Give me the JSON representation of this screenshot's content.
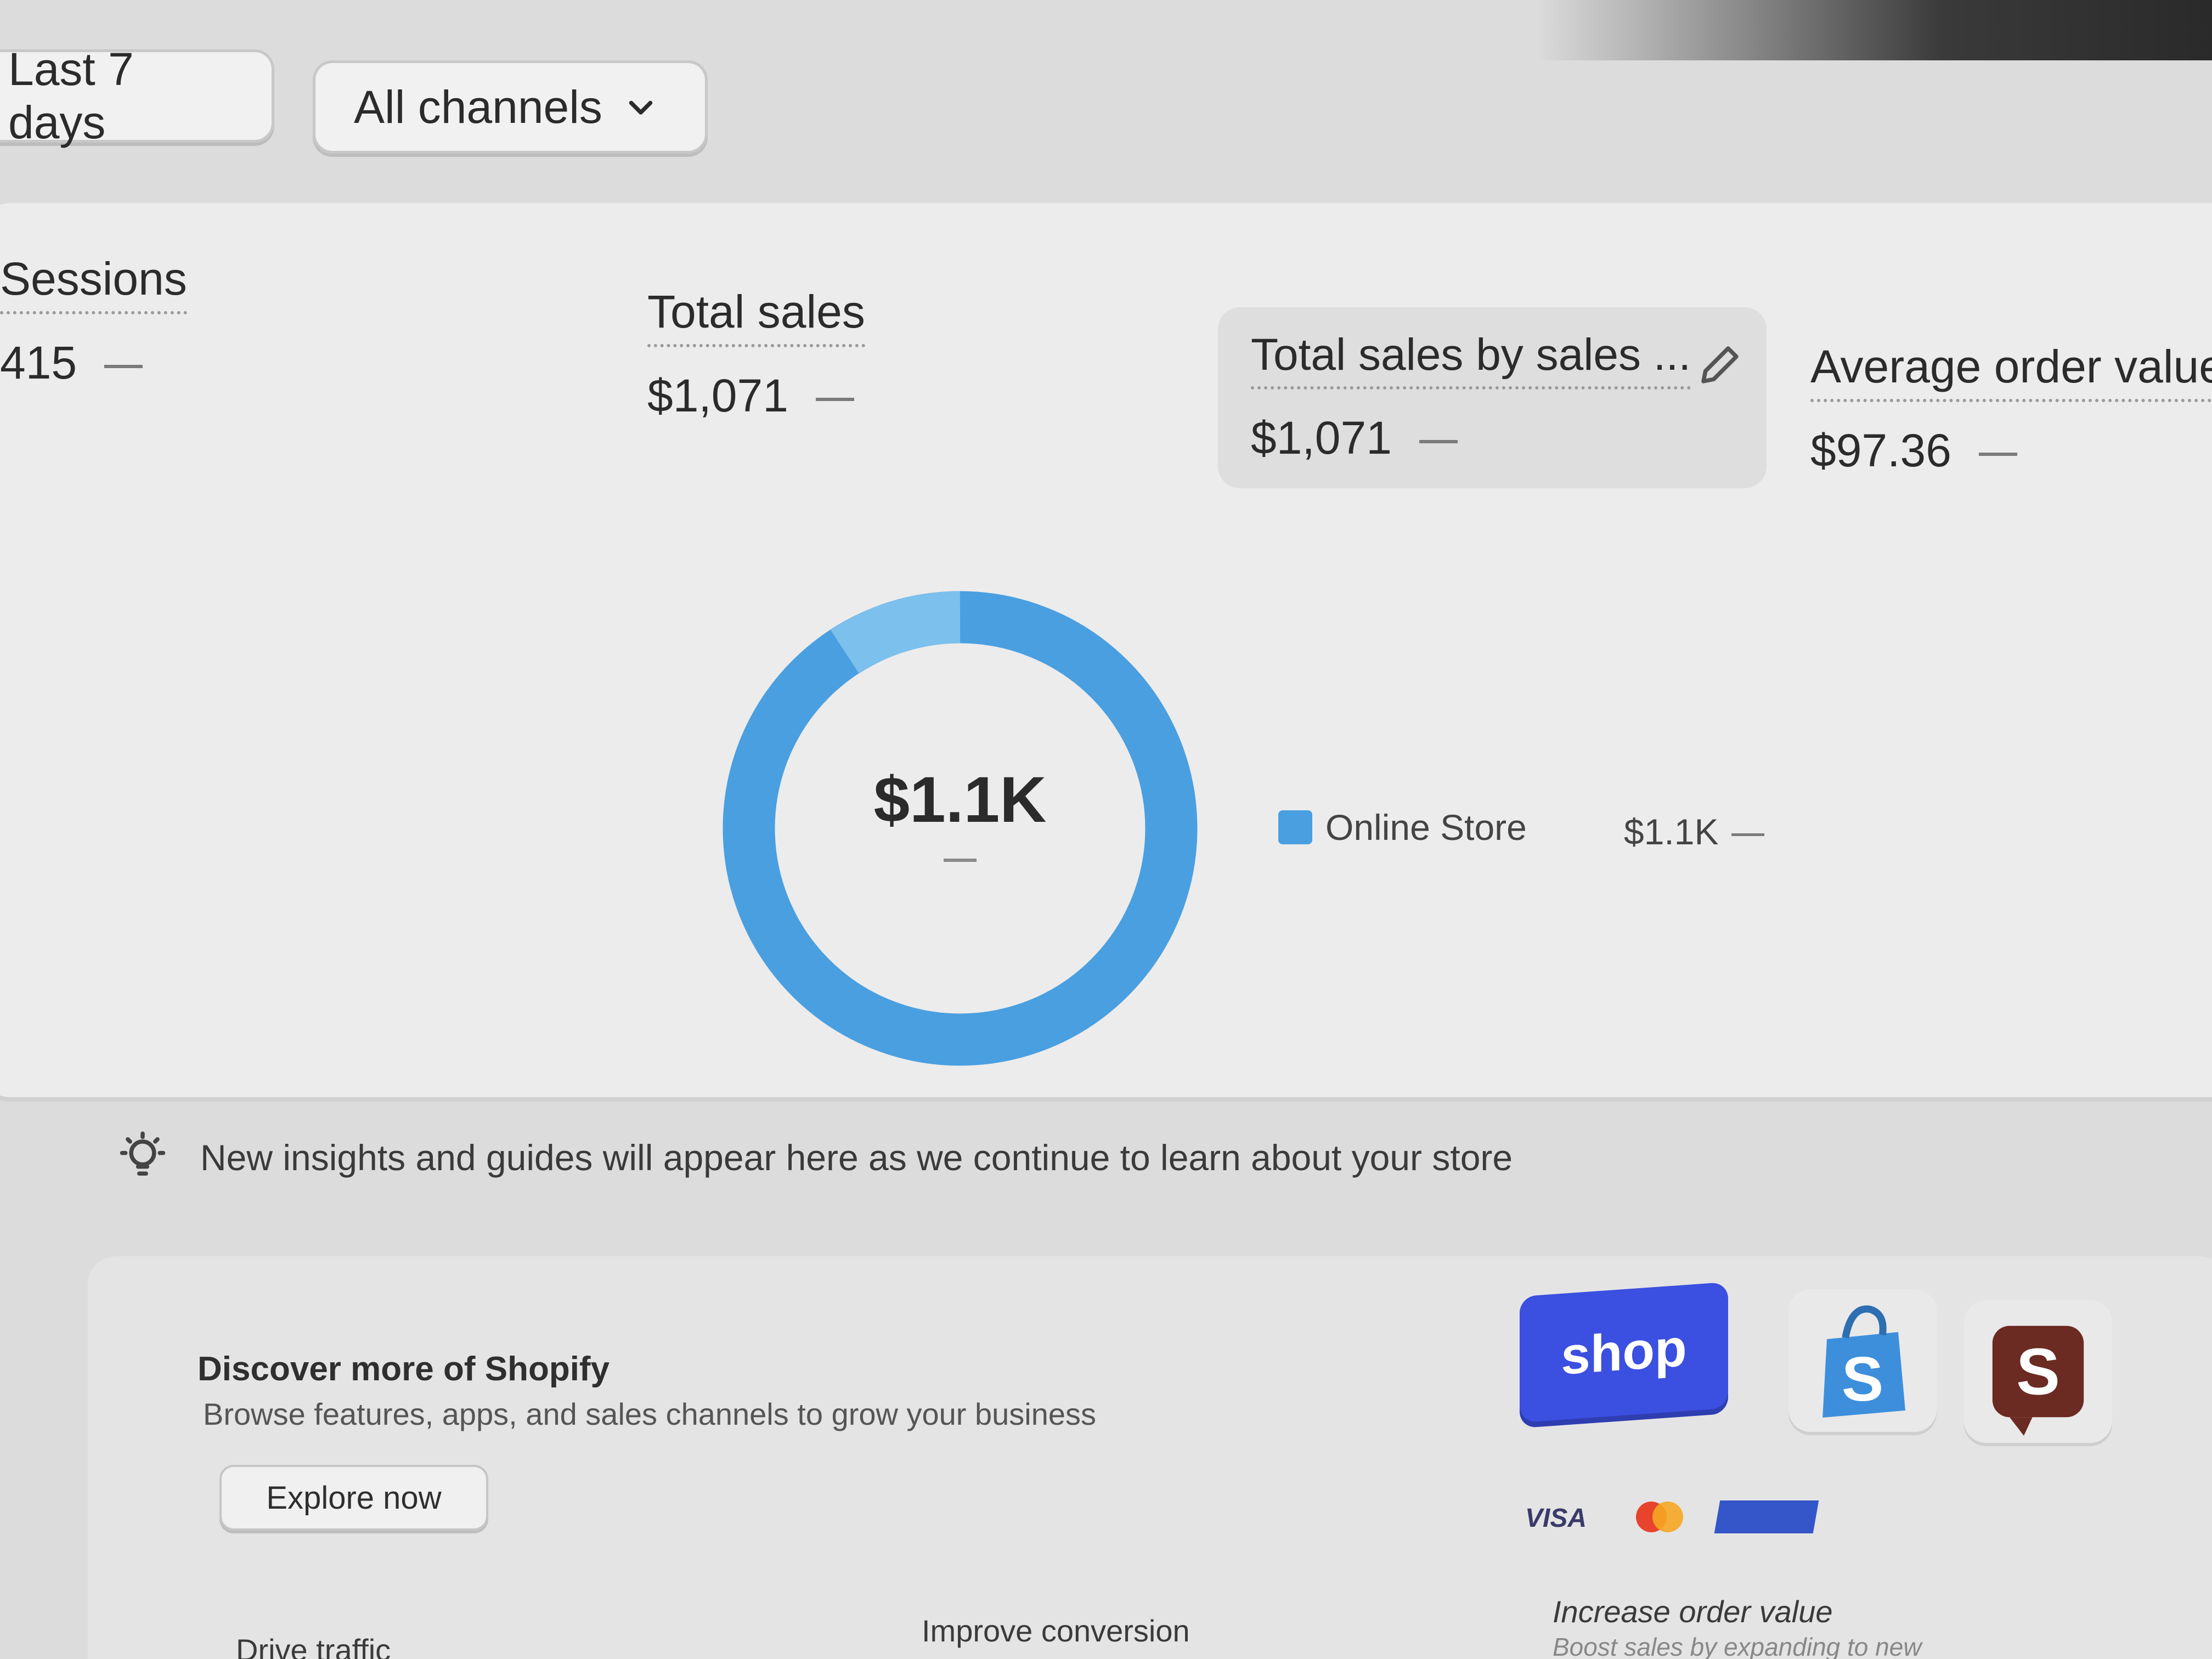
{
  "filters": {
    "date_label": "Last 7 days",
    "channels_label": "All channels"
  },
  "metrics": {
    "sessions": {
      "label": "Sessions",
      "value": "415"
    },
    "total_sales": {
      "label": "Total sales",
      "value": "$1,071"
    },
    "by_channel": {
      "label": "Total sales by sales ...",
      "value": "$1,071"
    },
    "aov": {
      "label": "Average order value",
      "value": "$97.36"
    }
  },
  "donut": {
    "center_value": "$1.1K",
    "legend_label": "Online Store",
    "legend_value": "$1.1K",
    "color_primary": "#4a9fe0",
    "color_highlight": "#7cc0ee"
  },
  "insight": {
    "text": "New insights and guides will appear here as we continue to learn about your store"
  },
  "discover": {
    "title": "Discover more of Shopify",
    "subtitle": "Browse features, apps, and sales channels to grow your business",
    "button": "Explore now",
    "shop_logo": "shop",
    "pay_visa": "VISA"
  },
  "bottom": {
    "drive": "Drive traffic",
    "improve": "Improve conversion",
    "increase": "Increase order value",
    "boost": "Boost sales by expanding to new"
  }
}
